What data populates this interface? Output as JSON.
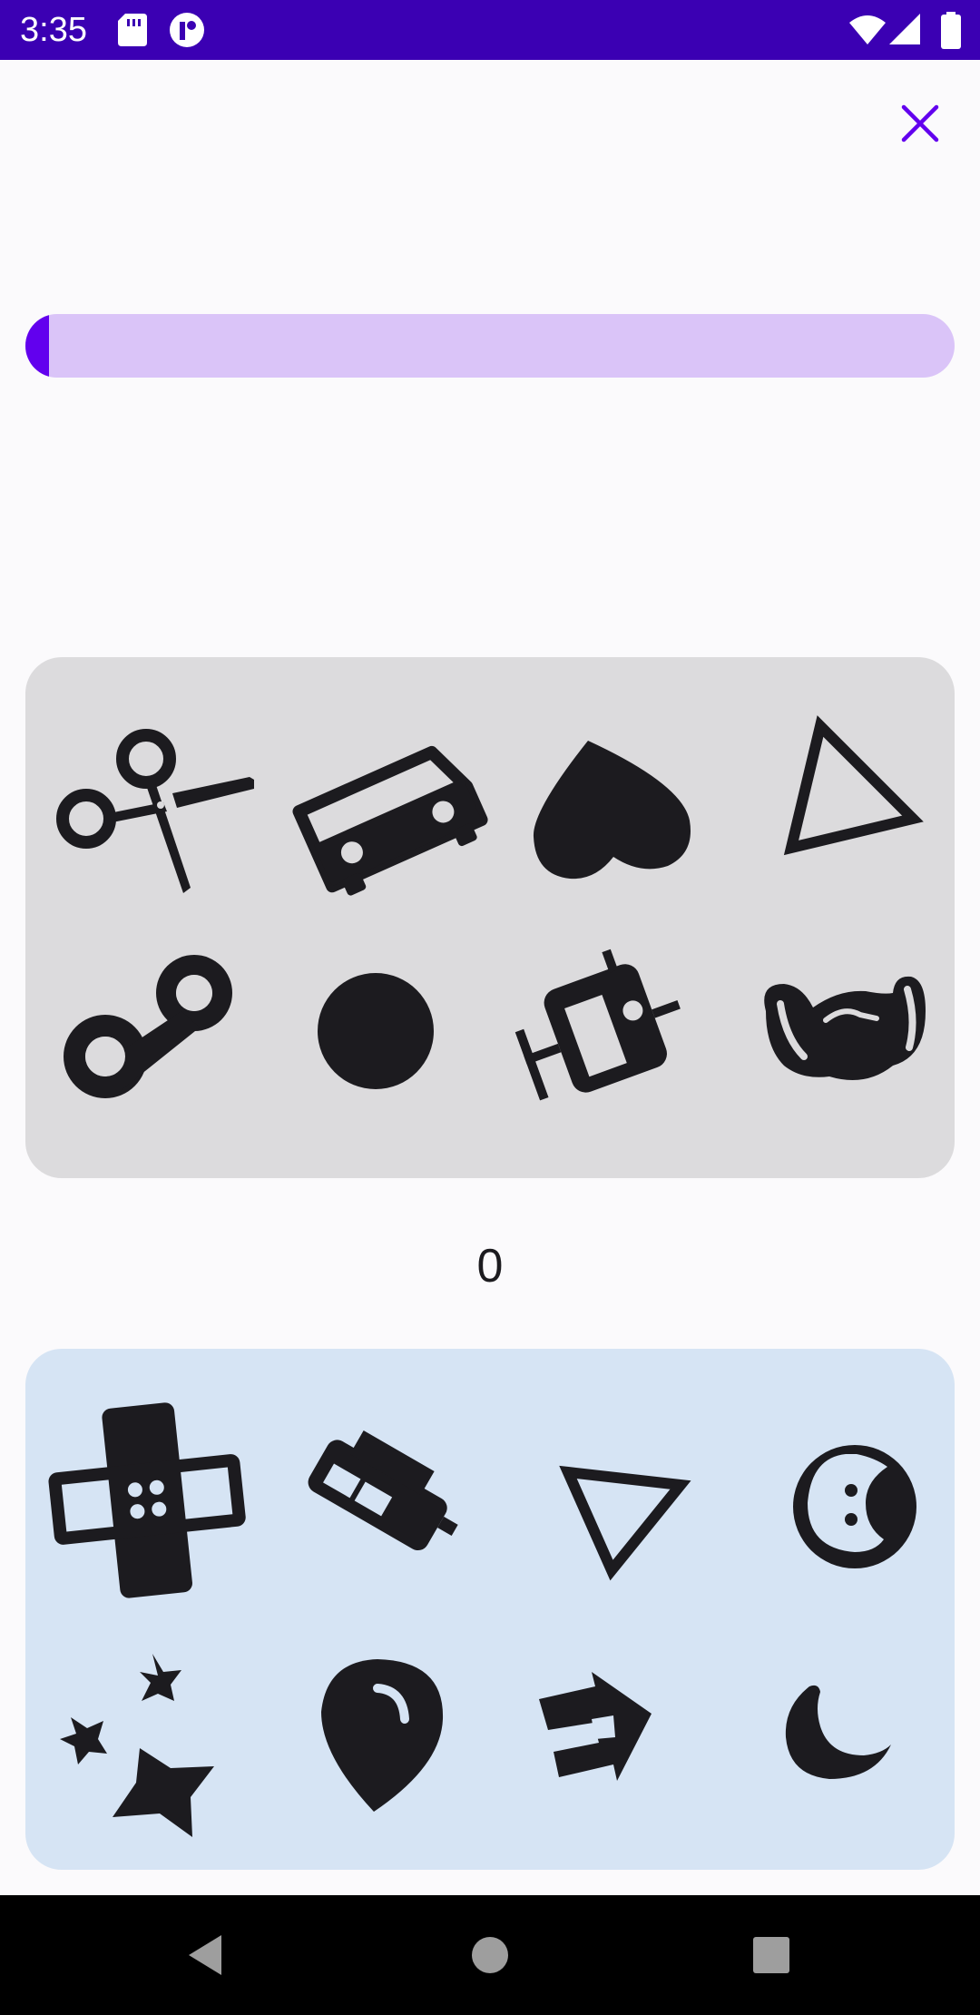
{
  "status_bar": {
    "time": "3:35",
    "left_icons": [
      "sd-card-icon",
      "app-notification-icon"
    ],
    "right_icons": [
      "wifi-icon",
      "cellular-signal-icon",
      "battery-icon"
    ],
    "background_color": "#3b00b3"
  },
  "header": {
    "close_icon": "close-icon",
    "accent_color": "#6200ee"
  },
  "progress": {
    "value_fraction": 0.025,
    "track_color": "#dac4f8",
    "fill_color": "#6200ee"
  },
  "top_panel": {
    "background_color": "#dcdbdd",
    "icons": [
      "scissors-icon",
      "car-icon",
      "heart-icon",
      "triangle-outline-icon",
      "reel-icon",
      "circle-icon",
      "robot-icon",
      "handshake-icon"
    ]
  },
  "score": {
    "value": "0"
  },
  "bottom_panel": {
    "background_color": "#d6e4f4",
    "icons": [
      "bandage-icon",
      "car-tilted-icon",
      "triangle-outline-icon",
      "face-icon",
      "sparkles-icon",
      "balloon-icon",
      "arrow-icon",
      "moon-icon"
    ]
  },
  "nav_bar": {
    "icons": [
      "back-icon",
      "home-icon",
      "recents-icon"
    ]
  }
}
